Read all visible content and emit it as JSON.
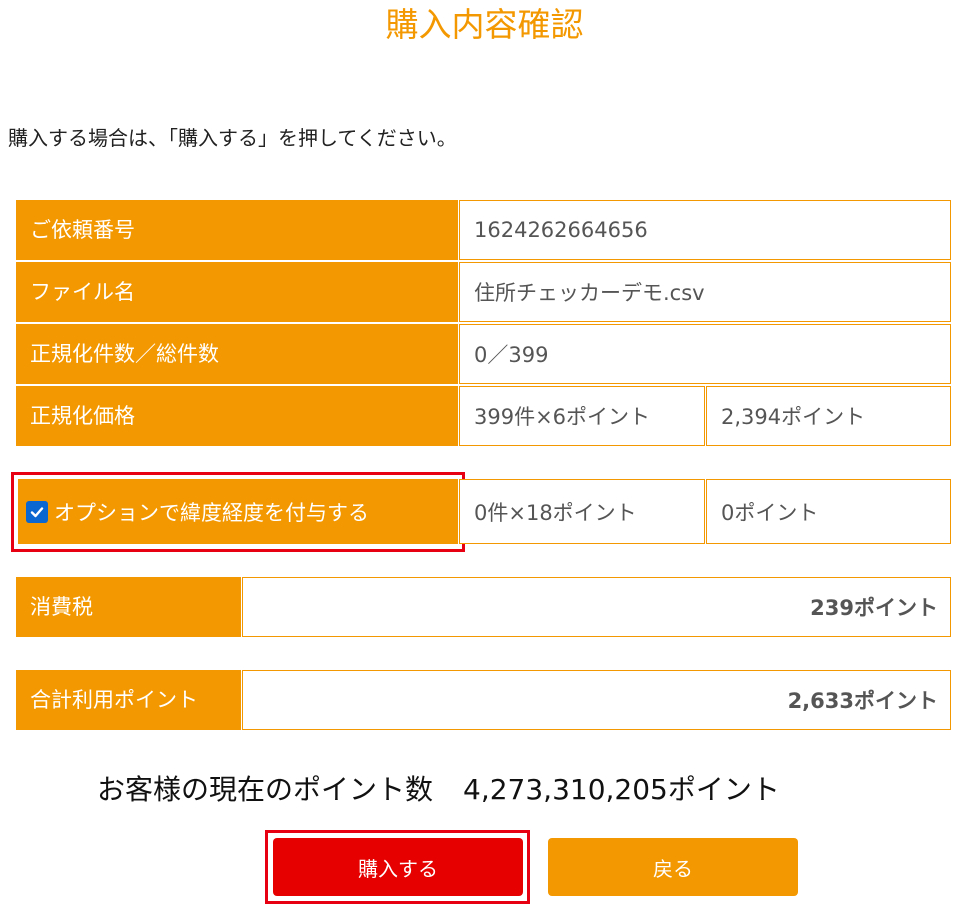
{
  "page_title": "購入内容確認",
  "instruction": "購入する場合は、「購入する」を押してください。",
  "rows": {
    "request_number": {
      "label": "ご依頼番号",
      "value": "1624262664656"
    },
    "file_name": {
      "label": "ファイル名",
      "value": "住所チェッカーデモ.csv"
    },
    "count": {
      "label": "正規化件数／総件数",
      "value": "0／399"
    },
    "price": {
      "label": "正規化価格",
      "unit": "399件×6ポイント",
      "total": "2,394ポイント"
    },
    "option": {
      "label": "オプションで緯度経度を付与する",
      "checked": true,
      "unit": "0件×18ポイント",
      "total": "0ポイント"
    },
    "tax": {
      "label": "消費税",
      "value": "239ポイント"
    },
    "total": {
      "label": "合計利用ポイント",
      "value": "2,633ポイント"
    }
  },
  "current_points": {
    "label": "お客様の現在のポイント数",
    "value": "4,273,310,205ポイント"
  },
  "buttons": {
    "buy": "購入する",
    "back": "戻る"
  },
  "colors": {
    "accent": "#f39800",
    "highlight": "#e60012",
    "buy_button": "#e60000",
    "checkbox": "#0a66d1"
  }
}
